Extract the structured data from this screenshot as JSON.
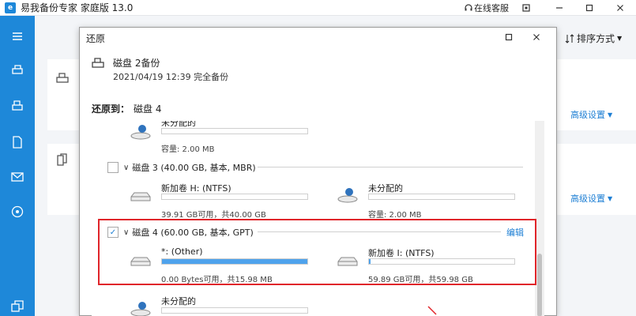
{
  "app": {
    "title": "易我备份专家 家庭版 13.0",
    "online_support": "在线客服",
    "logo_glyph": "e"
  },
  "toolbar": {
    "sort_label": "排序方式"
  },
  "background_cards": [
    {
      "advanced_label": "高级设置"
    },
    {
      "advanced_label": "高级设置"
    }
  ],
  "dialog": {
    "title": "还原",
    "source": {
      "name": "磁盘 2备份",
      "subtitle": "2021/04/19 12:39 完全备份"
    },
    "target_label": "还原到：",
    "target_value": "磁盘 4",
    "top_partial": {
      "name": "未分配的",
      "capacity": "容量: 2.00 MB"
    },
    "disk3": {
      "label": "磁盘 3 (40.00 GB, 基本, MBR)",
      "checked": false,
      "partitions": [
        {
          "name": "新加卷 H: (NTFS)",
          "capacity": "39.91 GB可用，共40.00 GB",
          "used_fraction": 0.0
        },
        {
          "name": "未分配的",
          "capacity": "容量: 2.00 MB",
          "used_fraction": 0.0
        }
      ]
    },
    "disk4": {
      "label": "磁盘 4 (60.00 GB, 基本, GPT)",
      "checked": true,
      "checkmark": "✓",
      "edit_label": "编辑",
      "partitions": [
        {
          "name": "*: (Other)",
          "capacity": "0.00 Bytes可用，共15.98 MB",
          "used_fraction": 1.0
        },
        {
          "name": "新加卷 I: (NTFS)",
          "capacity": "59.89 GB可用，共59.98 GB",
          "used_fraction": 0.01
        }
      ]
    },
    "bottom_partial": {
      "name": "未分配的"
    }
  },
  "colors": {
    "accent": "#1e88d9",
    "highlight": "#e0252a",
    "bar_fill": "#4fa3ec"
  }
}
